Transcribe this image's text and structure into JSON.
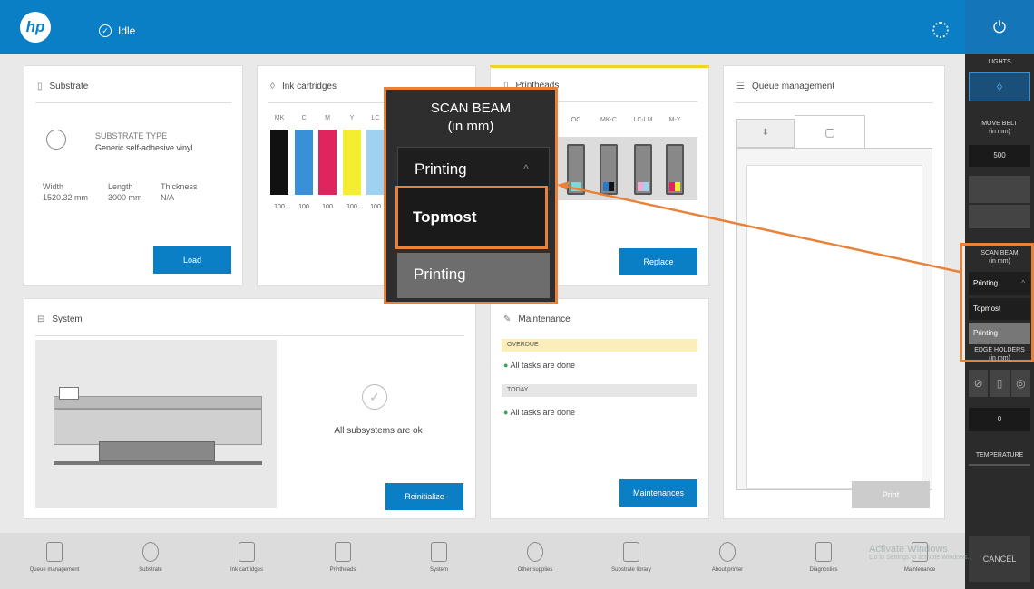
{
  "header": {
    "logo": "hp",
    "status": "Idle",
    "status_icon": "check-circle-icon"
  },
  "colors": {
    "brand": "#0a7fc6",
    "highlight": "#e8823a",
    "panel": "#2b2b2b"
  },
  "substrate": {
    "title": "Substrate",
    "type_label": "SUBSTRATE TYPE",
    "type_value": "Generic self-adhesive vinyl",
    "width_label": "Width",
    "width_value": "1520.32 mm",
    "length_label": "Length",
    "length_value": "3000 mm",
    "thickness_label": "Thickness",
    "thickness_value": "N/A",
    "load": "Load"
  },
  "ink": {
    "title": "Ink cartridges",
    "labels": [
      "MK",
      "C",
      "M",
      "Y",
      "LC"
    ],
    "levels": [
      "100",
      "100",
      "100",
      "100",
      "100"
    ],
    "colors": [
      "#111111",
      "#3a8fd9",
      "#e0245e",
      "#f5ee30",
      "#9fd2f0"
    ]
  },
  "printheads": {
    "title": "Printheads",
    "labels": [
      "OC",
      "MK-C",
      "LC-LM",
      "M-Y"
    ],
    "replace": "Replace"
  },
  "queue": {
    "title": "Queue management",
    "print": "Print"
  },
  "system": {
    "title": "System",
    "status": "All subsystems are ok",
    "reinit": "Reinitialize"
  },
  "maintenance": {
    "title": "Maintenance",
    "overdue": "OVERDUE",
    "overdue_text": "All tasks are done",
    "today": "TODAY",
    "today_text": "All tasks are done",
    "button": "Maintenances"
  },
  "zoom": {
    "title": "SCAN BEAM",
    "subtitle": "(in mm)",
    "selected": "Printing",
    "option1": "Topmost",
    "option2": "Printing"
  },
  "right": {
    "lights": "LIGHTS",
    "move_belt": "MOVE BELT",
    "move_belt_unit": "(in mm)",
    "move_belt_value": "500",
    "scan_beam": "SCAN BEAM",
    "scan_beam_unit": "(in mm)",
    "selected": "Printing",
    "opt1": "Topmost",
    "opt2": "Printing",
    "edge_holders": "EDGE HOLDERS",
    "edge_unit": "(in mm)",
    "edge_value": "0",
    "temperature": "TEMPERATURE",
    "cancel": "CANCEL"
  },
  "bottom": [
    "Queue management",
    "Substrate",
    "Ink cartridges",
    "Printheads",
    "System",
    "Other supplies",
    "Substrate library",
    "About printer",
    "Diagnostics",
    "Maintenance"
  ],
  "watermark": {
    "line1": "Activate Windows",
    "line2": "Go to Settings to activate Windows."
  }
}
